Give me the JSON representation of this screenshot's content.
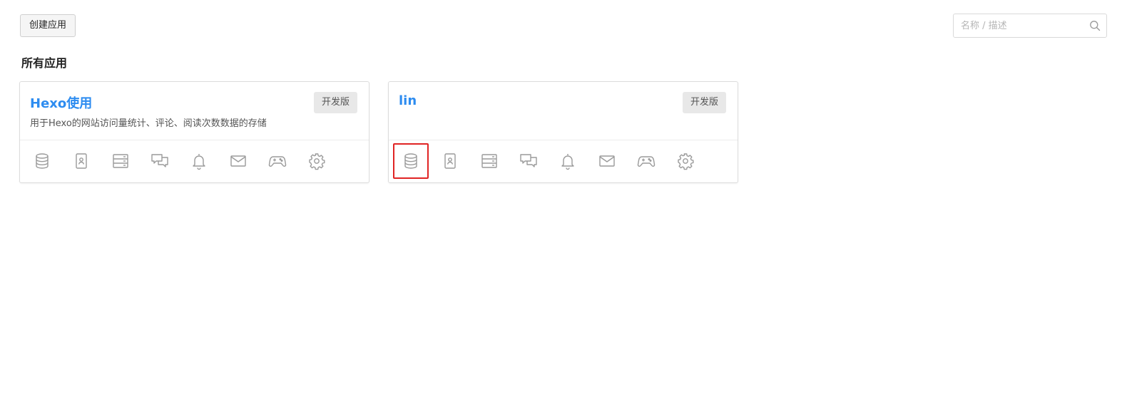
{
  "toolbar": {
    "create_label": "创建应用"
  },
  "search": {
    "placeholder": "名称 / 描述",
    "value": ""
  },
  "section": {
    "title": "所有应用"
  },
  "apps": [
    {
      "name": "Hexo使用",
      "description": "用于Hexo的网站访问量统计、评论、阅读次数数据的存储",
      "badge": "开发版",
      "icons": [
        "database-icon",
        "user-card-icon",
        "server-icon",
        "chat-icon",
        "bell-icon",
        "mail-icon",
        "gamepad-icon",
        "gear-icon"
      ]
    },
    {
      "name": "lin",
      "description": "",
      "badge": "开发版",
      "icons": [
        "database-icon",
        "user-card-icon",
        "server-icon",
        "chat-icon",
        "bell-icon",
        "mail-icon",
        "gamepad-icon",
        "gear-icon"
      ],
      "highlighted_icon": "database-icon"
    }
  ],
  "colors": {
    "title_link": "#2d8cf0",
    "icon_gray": "#9a9a9a",
    "highlight_border": "#e02424",
    "badge_bg": "#e8e8e8"
  }
}
